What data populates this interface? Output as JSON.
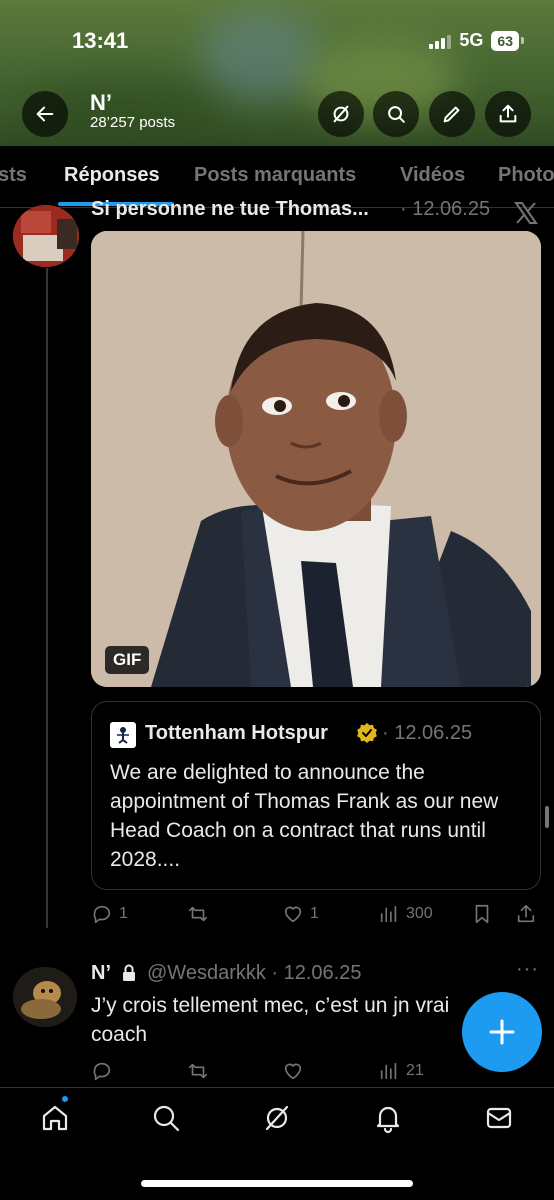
{
  "status": {
    "time": "13:41",
    "network": "5G",
    "battery": "63"
  },
  "header": {
    "name": "N’",
    "post_count": "28’257 posts"
  },
  "tabs": [
    {
      "label": "sts"
    },
    {
      "label": "Réponses"
    },
    {
      "label": "Posts marquants"
    },
    {
      "label": "Vidéos"
    },
    {
      "label": "Photo"
    }
  ],
  "post1": {
    "text_head": "Si personne ne tue Thomas...",
    "date": "· 12.06.25",
    "media_badge": "GIF",
    "quote": {
      "name": "Tottenham Hotspur",
      "date": "· 12.06.25",
      "text": "We are delighted to announce the appointment of Thomas Frank as our new Head Coach on a contract that runs until 2028...."
    },
    "actions": {
      "replies": "1",
      "reposts": "",
      "likes": "1",
      "views": "300"
    }
  },
  "post2": {
    "name": "N’",
    "handle": "@Wesdarkkk · 12.06.25",
    "more": "···",
    "text": "J’y crois tellement mec, c’est un jn vrai coach",
    "actions": {
      "replies": "",
      "reposts": "",
      "likes": "",
      "views": "21"
    }
  },
  "colors": {
    "accent": "#1d9bf0",
    "muted": "#71767b",
    "text": "#e7e9ea",
    "background": "#000000"
  }
}
